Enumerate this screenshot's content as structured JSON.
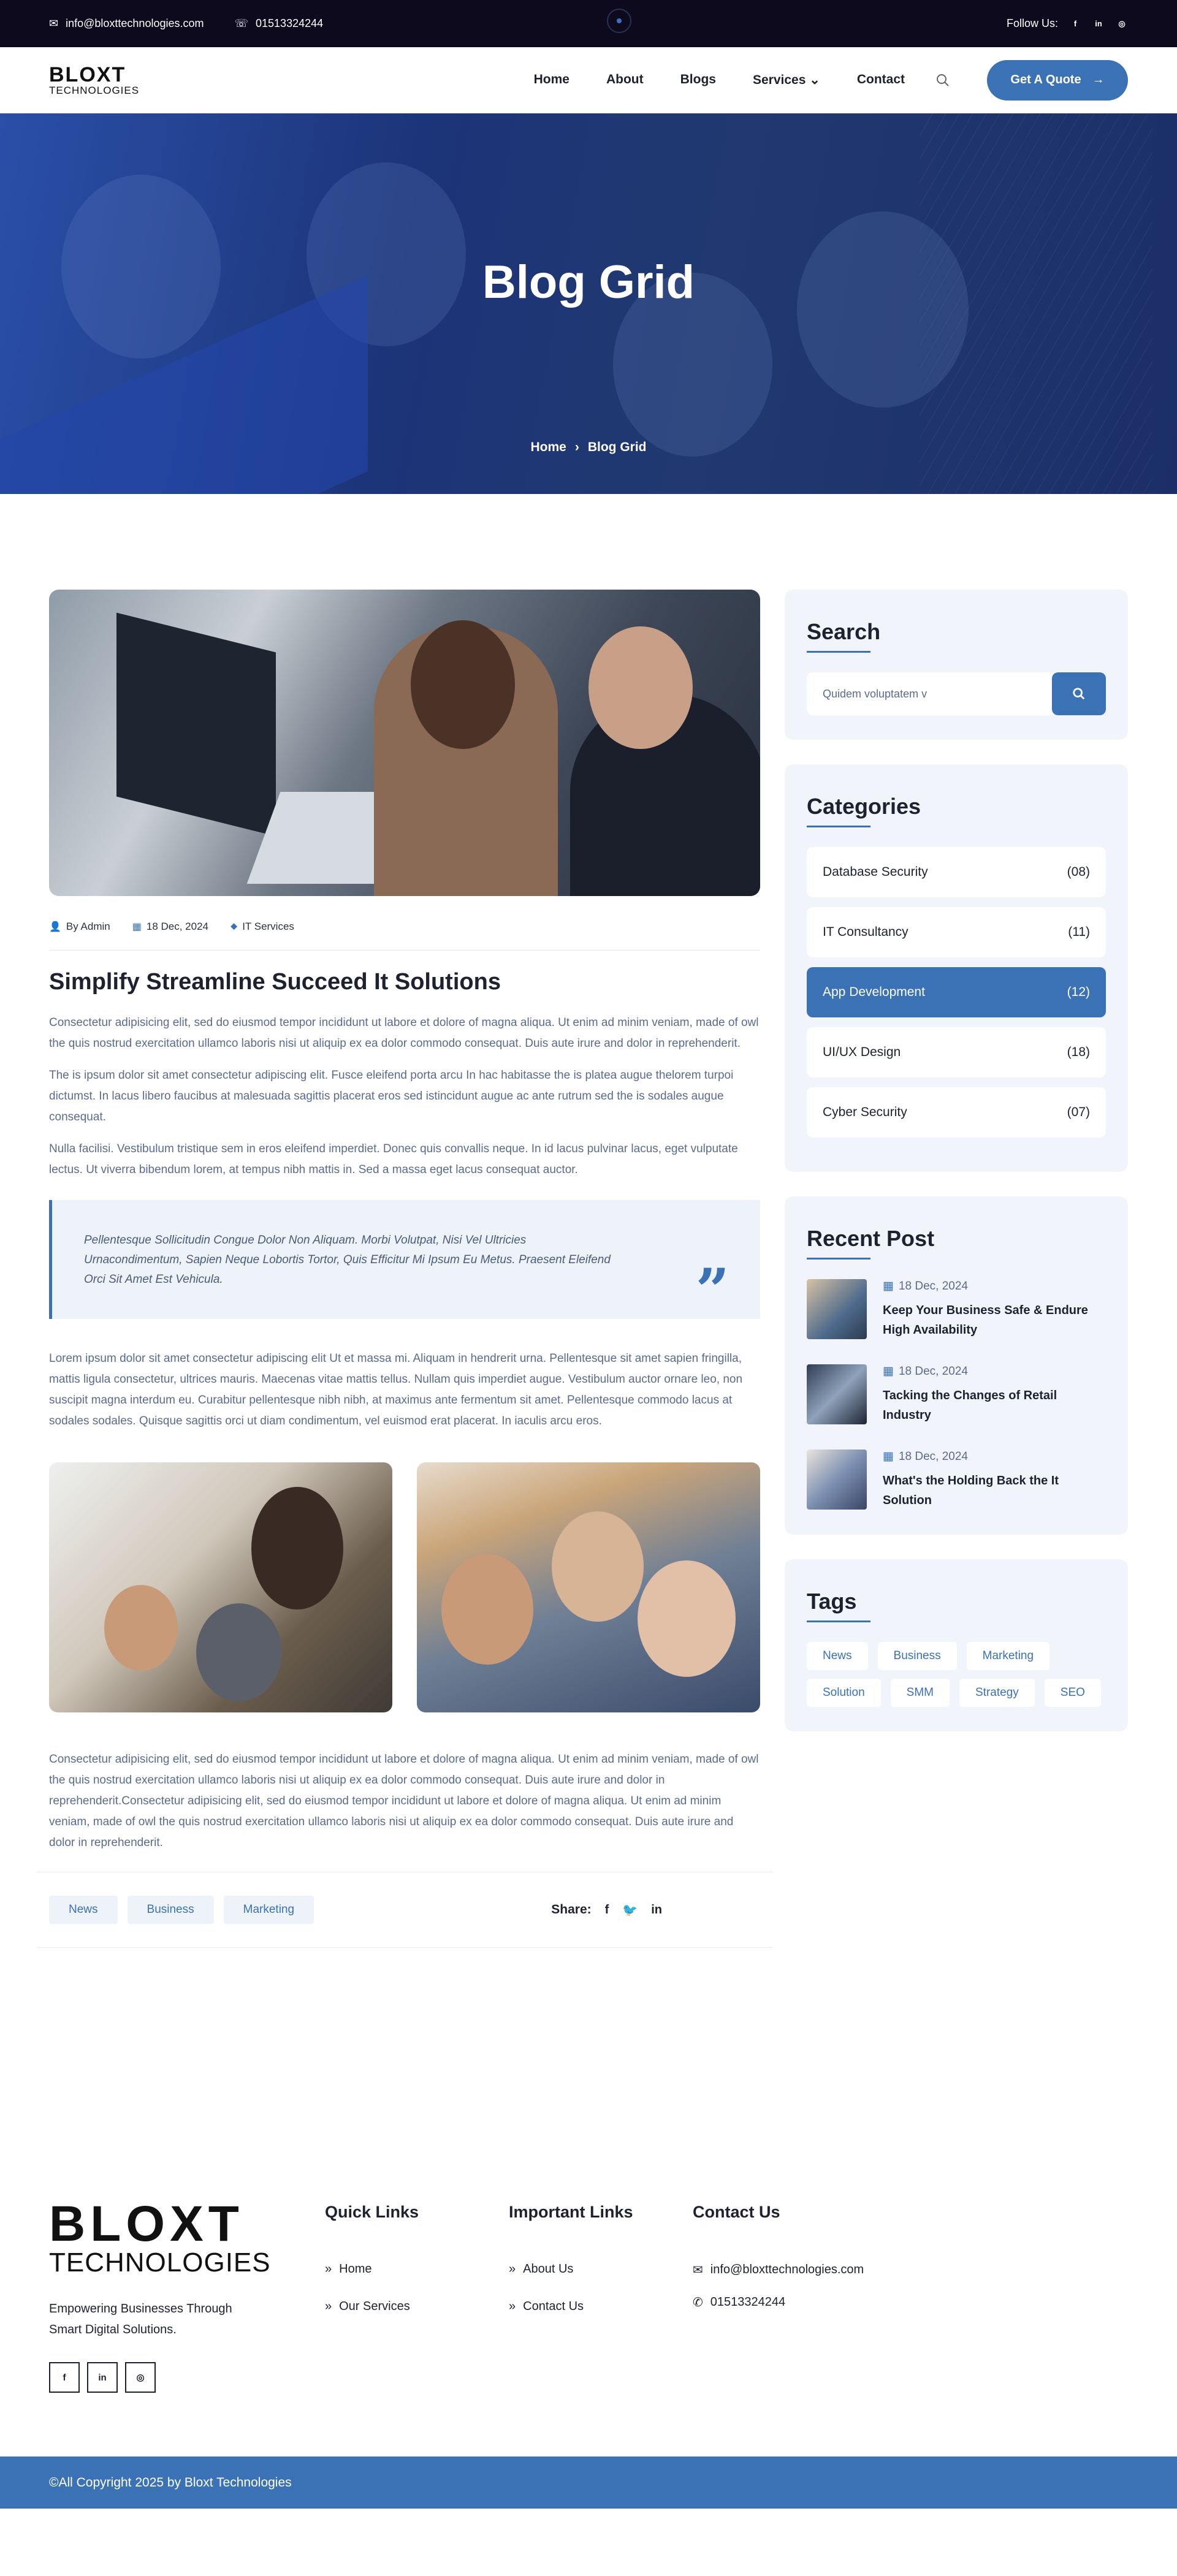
{
  "topbar": {
    "email": "info@bloxttechnologies.com",
    "phone": "01513324244",
    "follow_label": "Follow Us:",
    "social_icons": [
      "facebook-icon",
      "linkedin-icon",
      "instagram-icon"
    ]
  },
  "logo": {
    "line1": "BLOXT",
    "line2": "TECHNOLOGIES"
  },
  "nav": {
    "items": [
      "Home",
      "About",
      "Blogs",
      "Services",
      "Contact"
    ],
    "cta_label": "Get A Quote"
  },
  "hero": {
    "title": "Blog Grid",
    "crumb_home": "Home",
    "crumb_current": "Blog Grid"
  },
  "post": {
    "author": "By Admin",
    "date": "18 Dec, 2024",
    "category": "IT Services",
    "title": "Simplify Streamline Succeed It Solutions",
    "p1": "Consectetur adipisicing elit, sed do eiusmod tempor incididunt ut labore et dolore of magna aliqua. Ut enim ad minim veniam, made of owl the quis nostrud exercitation ullamco laboris nisi ut aliquip ex ea dolor commodo consequat. Duis aute irure and dolor in reprehenderit.",
    "p2": "The is ipsum dolor sit amet consectetur adipiscing elit. Fusce eleifend porta arcu In hac habitasse the is platea augue thelorem turpoi dictumst. In lacus libero faucibus at malesuada sagittis placerat eros sed istincidunt augue ac ante rutrum sed the is sodales augue consequat.",
    "p3": "Nulla facilisi. Vestibulum tristique sem in eros eleifend imperdiet. Donec quis convallis neque. In id lacus pulvinar lacus, eget vulputate lectus. Ut viverra bibendum lorem, at tempus nibh mattis in. Sed a massa eget lacus consequat auctor.",
    "quote": "Pellentesque Sollicitudin Congue Dolor Non Aliquam. Morbi Volutpat, Nisi Vel Ultricies Urnacondimentum, Sapien Neque Lobortis Tortor, Quis Efficitur Mi Ipsum Eu Metus. Praesent Eleifend Orci Sit Amet Est Vehicula.",
    "p4": "Lorem ipsum dolor sit amet consectetur adipiscing elit Ut et massa mi. Aliquam in hendrerit urna. Pellentesque sit amet sapien fringilla, mattis ligula consectetur, ultrices mauris. Maecenas vitae mattis tellus. Nullam quis imperdiet augue. Vestibulum auctor ornare leo, non suscipit magna interdum eu. Curabitur pellentesque nibh nibh, at maximus ante fermentum sit amet. Pellentesque commodo lacus at sodales sodales. Quisque sagittis orci ut diam condimentum, vel euismod erat placerat. In iaculis arcu eros.",
    "p5": "Consectetur adipisicing elit, sed do eiusmod tempor incididunt ut labore et dolore of magna aliqua. Ut enim ad minim veniam, made of owl the quis nostrud exercitation ullamco laboris nisi ut aliquip ex ea dolor commodo consequat. Duis aute irure and dolor in reprehenderit.Consectetur adipisicing elit, sed do eiusmod tempor incididunt ut labore et dolore of magna aliqua. Ut enim ad minim veniam, made of owl the quis nostrud exercitation ullamco laboris nisi ut aliquip ex ea dolor commodo consequat. Duis aute irure and dolor in reprehenderit.",
    "tags": [
      "News",
      "Business",
      "Marketing"
    ],
    "share_label": "Share:"
  },
  "sidebar": {
    "search_title": "Search",
    "search_placeholder": "Quidem voluptatem v",
    "categories_title": "Categories",
    "categories": [
      {
        "name": "Database Security",
        "count": "(08)"
      },
      {
        "name": "IT Consultancy",
        "count": "(11)"
      },
      {
        "name": "App Development",
        "count": "(12)"
      },
      {
        "name": "UI/UX Design",
        "count": "(18)"
      },
      {
        "name": "Cyber Security",
        "count": "(07)"
      }
    ],
    "recent_title": "Recent Post",
    "recent": [
      {
        "date": "18 Dec, 2024",
        "title": "Keep Your Business Safe & Endure High Availability"
      },
      {
        "date": "18 Dec, 2024",
        "title": "Tacking the Changes of Retail Industry"
      },
      {
        "date": "18 Dec, 2024",
        "title": "What's the Holding Back the It Solution"
      }
    ],
    "tags_title": "Tags",
    "tags": [
      "News",
      "Business",
      "Marketing",
      "Solution",
      "SMM",
      "Strategy",
      "SEO"
    ]
  },
  "footer": {
    "tagline": "Empowering Businesses Through Smart Digital Solutions.",
    "quick_title": "Quick Links",
    "quick": [
      "Home",
      "Our Services"
    ],
    "important_title": "Important Links",
    "important": [
      "About Us",
      "Contact Us"
    ],
    "contact_title": "Contact Us",
    "contact_email": "info@bloxttechnologies.com",
    "contact_phone": "01513324244",
    "copyright": "©All Copyright 2025 by Bloxt Technologies"
  },
  "colors": {
    "accent": "#3a72b5",
    "topbar": "#0d0a1e",
    "card": "#f1f5fb"
  }
}
